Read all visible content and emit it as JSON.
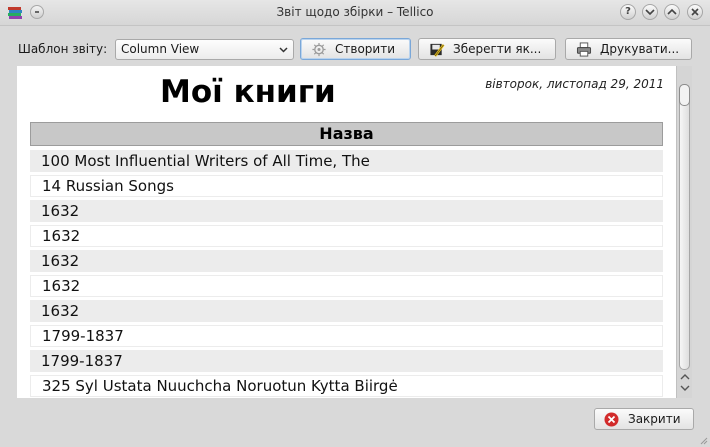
{
  "window": {
    "title": "Звіт щодо збірки – Tellico",
    "icons": {
      "app": "books-app-icon",
      "pin": "pin-icon",
      "help": "help-icon",
      "minimize": "minimize-icon",
      "maximize": "maximize-icon",
      "close": "close-icon"
    },
    "help_glyph": "?"
  },
  "toolbar": {
    "template_label": "Шаблон звіту:",
    "template_value": "Column View",
    "generate_label": "Створити",
    "save_label": "Зберегти як...",
    "print_label": "Друкувати..."
  },
  "report": {
    "title": "Мої книги",
    "date": "вівторок, листопад 29, 2011",
    "column_header": "Назва",
    "rows": [
      "100 Most Influential Writers of All Time, The",
      "14 Russian Songs",
      "1632",
      "1632",
      "1632",
      "1632",
      "1632",
      "1799-1837",
      "1799-1837",
      "325 Syl Ustata Nuuchcha Noruotun Kytta Biirgė"
    ]
  },
  "footer": {
    "close_label": "Закрити"
  },
  "colors": {
    "header_bg": "#c8c8c8",
    "row_alt_bg": "#ececec",
    "close_icon_red": "#d22b2b"
  }
}
